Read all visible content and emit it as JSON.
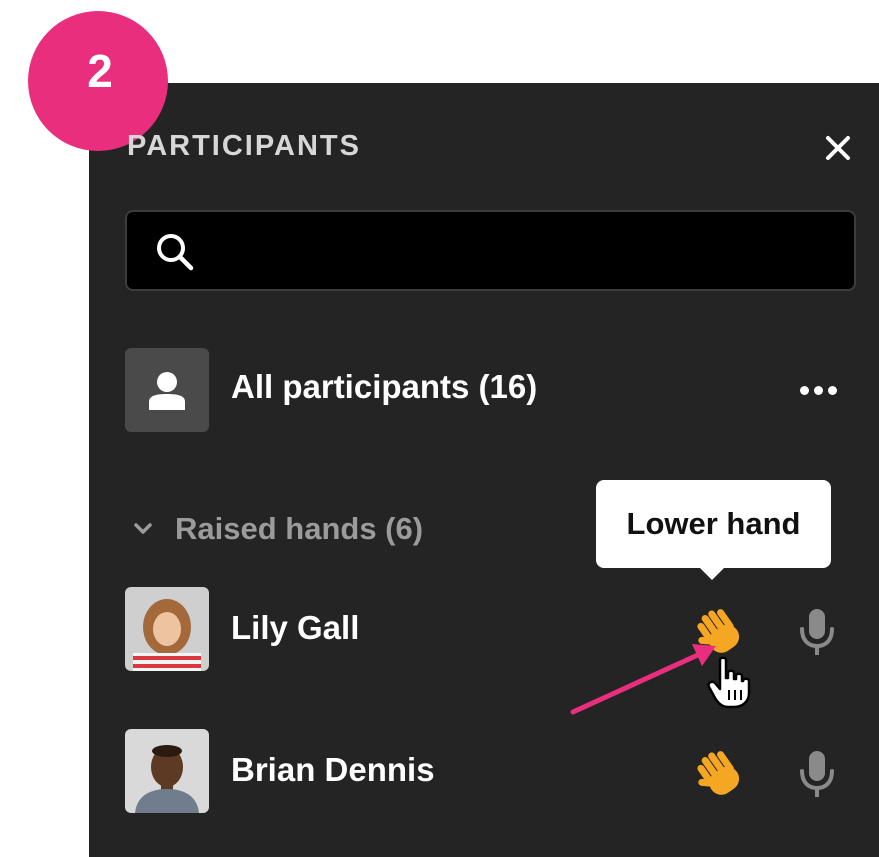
{
  "step": {
    "number": "2"
  },
  "panel": {
    "title": "PARTICIPANTS",
    "close_icon": "close-icon"
  },
  "search": {
    "value": "",
    "placeholder": "",
    "icon": "search-icon"
  },
  "all_participants": {
    "label": "All participants (16)",
    "avatar_icon": "person-icon",
    "more_icon": "more-options-icon"
  },
  "raised_hands": {
    "label": "Raised hands (6)",
    "chevron_icon": "chevron-down-icon",
    "participants": [
      {
        "name": "Lily Gall",
        "hand_icon": "raised-hand-icon",
        "mic_icon": "microphone-icon"
      },
      {
        "name": "Brian Dennis",
        "hand_icon": "raised-hand-icon",
        "mic_icon": "microphone-icon"
      }
    ]
  },
  "tooltip": {
    "text": "Lower hand"
  },
  "colors": {
    "panel_bg": "#242424",
    "badge": "#ea2e7e",
    "annotation_arrow": "#ea2e7e",
    "hand": "#f5a623",
    "text": "#ffffff",
    "muted_text": "#9b9b9b",
    "mic": "#8a8a8a"
  }
}
